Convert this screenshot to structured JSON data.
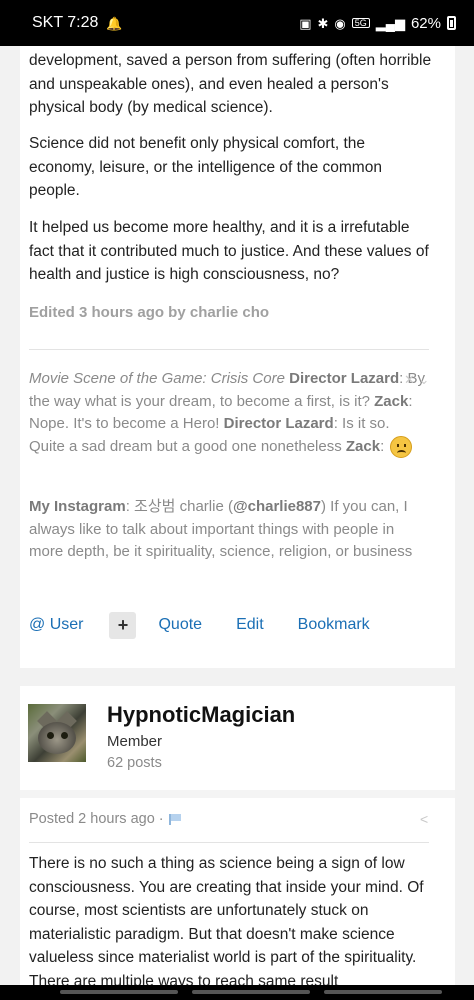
{
  "status_bar": {
    "carrier_time": "SKT 7:28",
    "network": "5G",
    "battery": "62%"
  },
  "post1": {
    "paragraphs": [
      "development, saved a person from suffering (often horrible and unspeakable ones), and even healed a person's physical body (by medical science).",
      "Science did not benefit only physical comfort, the economy, leisure, or the intelligence of the common people.",
      "It helped us become more healthy, and it is a irrefutable fact that it contributed much to justice. And these values of health and justice is high consciousness, no?"
    ],
    "edited": "Edited 3 hours ago by charlie cho",
    "signature": {
      "movie_intro": "Movie Scene of the Game: Crisis Core",
      "speaker1": "Director Lazard",
      "line1": ": By the way what is your dream, to become a first, is it? ",
      "speaker2": "Zack",
      "line2": ": Nope. It's to become a Hero! ",
      "speaker3": "Director Lazard",
      "line3": ": Is it so. Quite a sad dream but a good one nonetheless ",
      "speaker4": "Zack",
      "line4": ": ",
      "close_glyph": "✕ ⌄",
      "insta_label": "My Instagram",
      "insta_text1": ": 조상범 charlie (",
      "insta_handle": "@charlie887",
      "insta_text2": ") If you can, I always like to talk about important things with people in more depth, be it spirituality, science, religion, or business"
    },
    "actions": {
      "user": "@ User",
      "plus": "+",
      "quote": "Quote",
      "edit": "Edit",
      "bookmark": "Bookmark"
    }
  },
  "post2": {
    "author": "HypnoticMagician",
    "role": "Member",
    "posts": "62 posts",
    "posted": "Posted 2 hours ago ·",
    "share_icon": "share-icon",
    "text": "There is no such a thing as science being a sign of  low consciousness. You are creating that inside your mind. Of course, most scientists are unfortunately stuck on materialistic paradigm. But that doesn't make science valueless since materialist world is part of the spirituality. There are multiple ways to reach same result"
  }
}
